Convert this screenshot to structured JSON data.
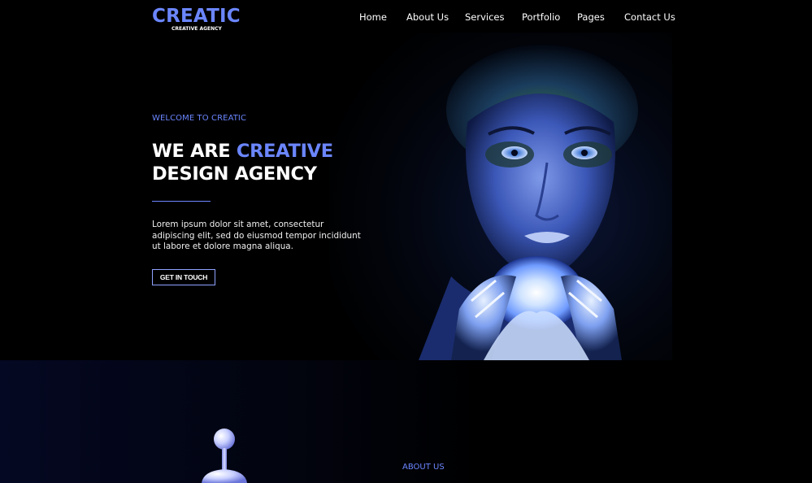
{
  "brand": {
    "name": "CREATIC",
    "tagline": "CREATIVE AGENCY",
    "accent_color": "#6b86ff"
  },
  "nav": {
    "items": [
      {
        "label": "Home"
      },
      {
        "label": "About Us"
      },
      {
        "label": "Services"
      },
      {
        "label": "Portfolio"
      },
      {
        "label": "Pages"
      },
      {
        "label": "Contact Us"
      }
    ]
  },
  "hero": {
    "kicker": "WELCOME TO CREATIC",
    "headline_part1": "WE ARE ",
    "headline_accent": "CREATIVE",
    "headline_line2": "DESIGN AGENCY",
    "body": "Lorem ipsum dolor sit amet, consectetur adipiscing elit, sed do eiusmod tempor incididunt ut labore et dolore magna aliqua.",
    "cta_label": "GET IN TOUCH",
    "image_icon": "glowing-portrait-image"
  },
  "about": {
    "kicker": "ABOUT US",
    "figure_icon": "3d-joystick-figure"
  }
}
